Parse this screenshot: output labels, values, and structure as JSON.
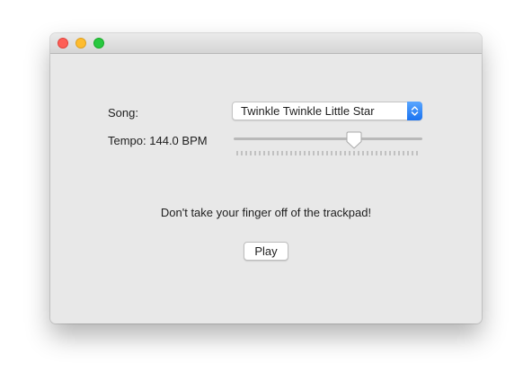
{
  "window": {
    "controls": [
      "close-icon",
      "minimize-icon",
      "zoom-icon"
    ]
  },
  "song": {
    "label": "Song:",
    "selected": "Twinkle Twinkle Little Star"
  },
  "tempo": {
    "label_prefix": "Tempo: ",
    "value": "144.0",
    "unit": " BPM",
    "slider_fraction": 0.65,
    "tick_count": 41
  },
  "instructions": "Don't take your finger off of the trackpad!",
  "play_button": {
    "label": "Play"
  },
  "colors": {
    "close": "#fe5f57",
    "minimize": "#febc2e",
    "zoom": "#28c840",
    "accent": "#1a73f0",
    "window_bg": "#e8e8e8"
  }
}
